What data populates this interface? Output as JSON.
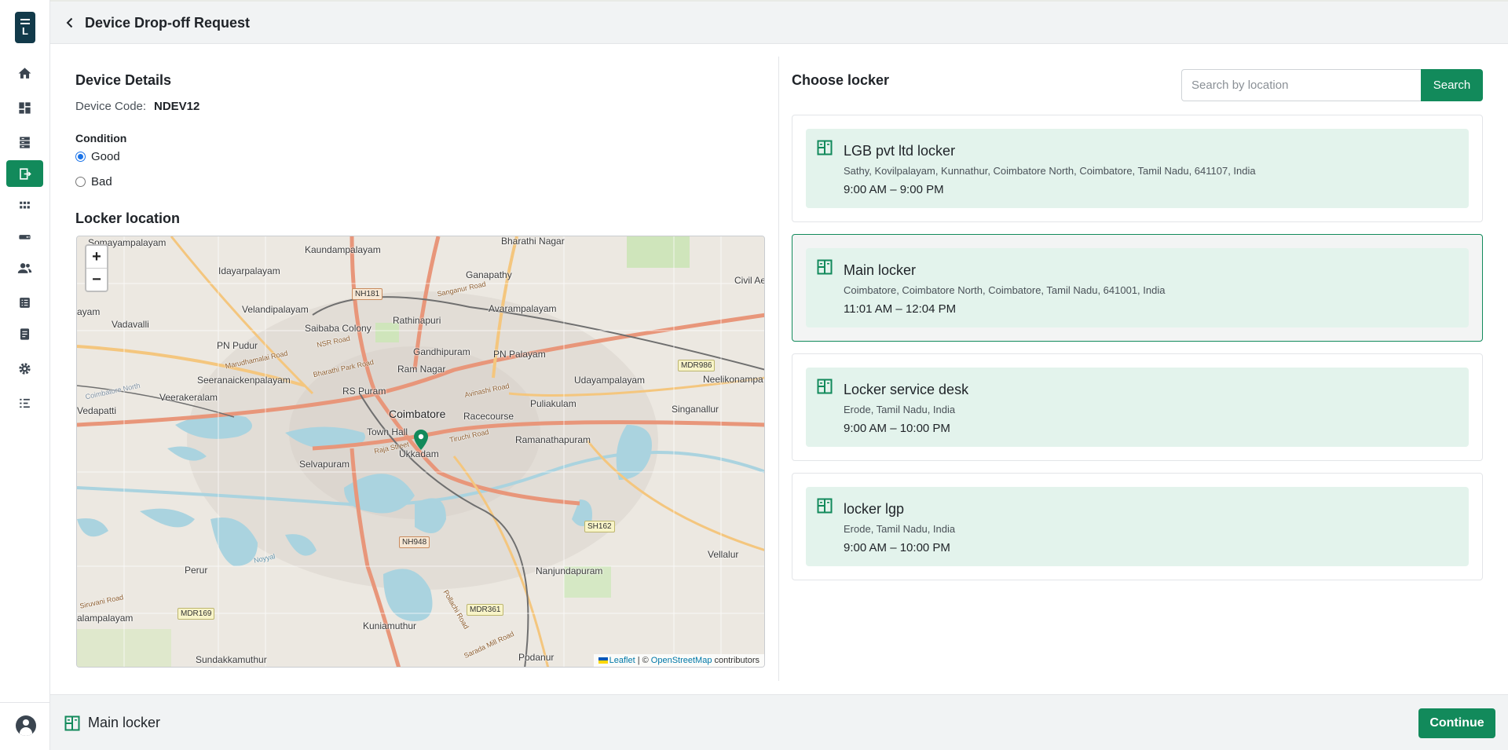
{
  "header": {
    "title": "Device Drop-off Request"
  },
  "sidebar": {
    "items": [
      {
        "icon": "home-icon"
      },
      {
        "icon": "dashboard-icon"
      },
      {
        "icon": "storage-icon"
      },
      {
        "icon": "locker-transfer-icon",
        "active": true
      },
      {
        "icon": "apps-grid-icon"
      },
      {
        "icon": "device-icon"
      },
      {
        "icon": "users-icon"
      },
      {
        "icon": "list-icon"
      },
      {
        "icon": "document-icon"
      },
      {
        "icon": "settings-icon"
      },
      {
        "icon": "checklist-icon"
      }
    ]
  },
  "device": {
    "section_title": "Device Details",
    "code_label": "Device Code:",
    "code_value": "NDEV12",
    "condition_label": "Condition",
    "conditions": [
      {
        "label": "Good",
        "checked": true
      },
      {
        "label": "Bad",
        "checked": false
      }
    ]
  },
  "map": {
    "title": "Locker location",
    "zoom_in": "+",
    "zoom_out": "−",
    "labels": [
      "Somayampalayam",
      "Kaundampalayam",
      "Bharathi Nagar",
      "Idayarpalayam",
      "Ganapathy",
      "Civil Ae",
      "ayam",
      "Velandipalayam",
      "Rathinapuri",
      "Avarampalayam",
      "Vadavalli",
      "Saibaba Colony",
      "PN Pudur",
      "Gandhipuram",
      "PN Palayam",
      "Ram Nagar",
      "Seeranaickenpalayam",
      "RS Puram",
      "Udayampalayam",
      "Neelikonampa",
      "Veerakeralam",
      "Coimbatore",
      "Racecourse",
      "Puliakulam",
      "Vedapatti",
      "Singanallur",
      "Town Hall",
      "Ramanathapuram",
      "Ukkadam",
      "Selvapuram",
      "Perur",
      "Nanjundapuram",
      "Vellalur",
      "alampalayam",
      "Kuniamuthur",
      "Sundakkamuthur",
      "Podanur"
    ],
    "road_labels": [
      "Marudhamalai Road",
      "NSR Road",
      "Bharathi Park Road",
      "Tiruchi Road",
      "Raja Street",
      "Sanganur Road",
      "Avinashi Road",
      "Siruvani Road",
      "Coimbatore North",
      "Noyyal",
      "Pollachi Road",
      "Sarada Mill Road"
    ],
    "shields": [
      "NH181",
      "MDR986",
      "NH948",
      "SH162",
      "MDR169",
      "MDR361"
    ],
    "attribution_leaflet": "Leaflet",
    "attribution_sep": "| ©",
    "attribution_osm": "OpenStreetMap",
    "attribution_tail": "contributors"
  },
  "lockers": {
    "title": "Choose locker",
    "search_placeholder": "Search by location",
    "search_button": "Search",
    "items": [
      {
        "name": "LGB pvt ltd locker",
        "address": "Sathy, Kovilpalayam, Kunnathur, Coimbatore North, Coimbatore, Tamil Nadu, 641107, India",
        "hours": "9:00 AM – 9:00 PM",
        "selected": false
      },
      {
        "name": "Main locker",
        "address": "Coimbatore, Coimbatore North, Coimbatore, Tamil Nadu, 641001, India",
        "hours": "11:01 AM – 12:04 PM",
        "selected": true
      },
      {
        "name": "Locker service desk",
        "address": "Erode, Tamil Nadu, India",
        "hours": "9:00 AM – 10:00 PM",
        "selected": false
      },
      {
        "name": "locker lgp",
        "address": "Erode, Tamil Nadu, India",
        "hours": "9:00 AM – 10:00 PM",
        "selected": false
      }
    ]
  },
  "footer": {
    "selected_locker": "Main locker",
    "continue_button": "Continue"
  },
  "colors": {
    "accent": "#128a5b",
    "card_bg": "#e3f3ec",
    "header_bg": "#f1f3f4"
  }
}
